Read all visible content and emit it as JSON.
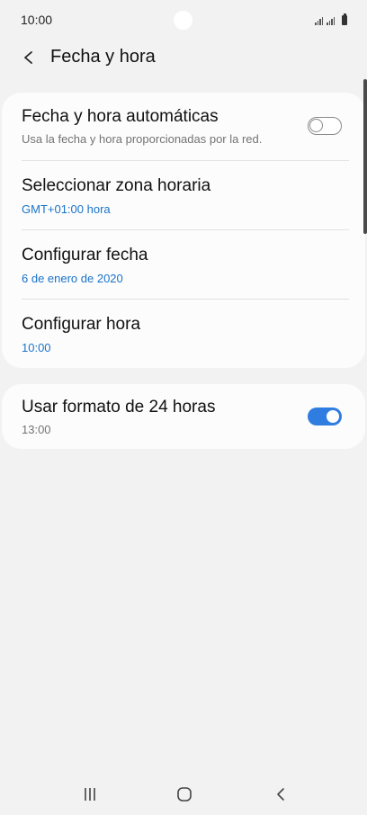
{
  "status_bar": {
    "time": "10:00"
  },
  "header": {
    "title": "Fecha y hora"
  },
  "settings_group_1": {
    "items": [
      {
        "title": "Fecha y hora automáticas",
        "subtitle": "Usa la fecha y hora proporcionadas por la red.",
        "toggle": "off"
      },
      {
        "title": "Seleccionar zona horaria",
        "subtitle": "GMT+01:00 hora"
      },
      {
        "title": "Configurar fecha",
        "subtitle": "6 de enero de 2020"
      },
      {
        "title": "Configurar hora",
        "subtitle": "10:00"
      }
    ]
  },
  "settings_group_2": {
    "items": [
      {
        "title": "Usar formato de 24 horas",
        "subtitle": "13:00",
        "toggle": "on"
      }
    ]
  },
  "colors": {
    "accent": "#2f7de1",
    "link_text": "#1a73c9",
    "background": "#f2f2f2",
    "card": "#fcfcfc"
  },
  "icons": {
    "back": "chevron-left-icon",
    "nav_recents": "recents-icon",
    "nav_home": "home-icon",
    "nav_back": "back-icon"
  }
}
